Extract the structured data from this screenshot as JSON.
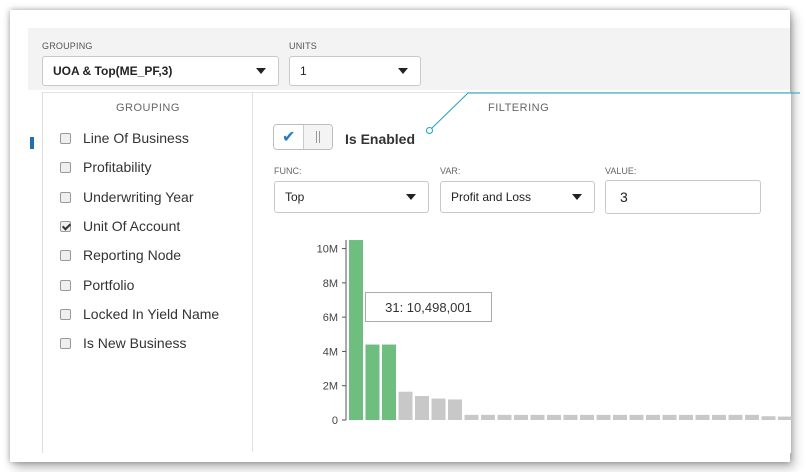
{
  "toolbar": {
    "grouping_label": "GROUPING",
    "grouping_value": "UOA & Top(ME_PF,3)",
    "units_label": "UNITS",
    "units_value": "1"
  },
  "grouping_panel": {
    "title": "GROUPING",
    "items": [
      {
        "label": "Line Of Business",
        "checked": false
      },
      {
        "label": "Profitability",
        "checked": false
      },
      {
        "label": "Underwriting Year",
        "checked": false
      },
      {
        "label": "Unit Of Account",
        "checked": true
      },
      {
        "label": "Reporting Node",
        "checked": false
      },
      {
        "label": "Portfolio",
        "checked": false
      },
      {
        "label": "Locked In Yield Name",
        "checked": false
      },
      {
        "label": "Is New Business",
        "checked": false
      }
    ]
  },
  "filtering_panel": {
    "title": "FILTERING",
    "enabled_label": "Is Enabled",
    "enabled": true,
    "func_label": "FUNC:",
    "func_value": "Top",
    "var_label": "VAR:",
    "var_value": "Profit and Loss",
    "value_label": "VALUE:",
    "value_value": "3"
  },
  "chart_data": {
    "type": "bar",
    "y_ticks": [
      "0",
      "2M",
      "4M",
      "6M",
      "8M",
      "10M"
    ],
    "ylim": [
      0,
      10500000
    ],
    "values": [
      10498001,
      4400000,
      4400000,
      1650000,
      1400000,
      1250000,
      1200000,
      300000,
      300000,
      300000,
      300000,
      300000,
      300000,
      300000,
      300000,
      300000,
      300000,
      300000,
      300000,
      300000,
      300000,
      300000,
      300000,
      300000,
      300000,
      220000,
      200000
    ],
    "highlighted_count": 3,
    "tooltip": "31: 10,498,001",
    "colors": {
      "highlight": "#6dbe7f",
      "other": "#c8c8c8"
    }
  }
}
